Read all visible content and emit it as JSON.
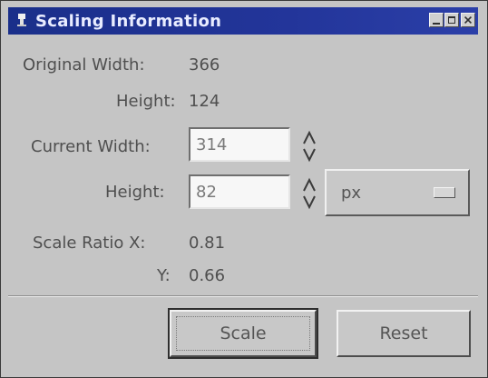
{
  "window": {
    "title": "Scaling Information",
    "icon": "app-icon",
    "controls": [
      "minimize-icon",
      "maximize-icon",
      "close-icon"
    ]
  },
  "original": {
    "width_label": "Original Width:",
    "width_value": "366",
    "height_label": "Height:",
    "height_value": "124"
  },
  "current": {
    "width_label": "Current Width:",
    "width_value": "314",
    "height_label": "Height:",
    "height_value": "82",
    "unit": "px"
  },
  "ratio": {
    "x_label": "Scale Ratio X:",
    "x_value": "0.81",
    "y_label": "Y:",
    "y_value": "0.66"
  },
  "buttons": {
    "scale": "Scale",
    "reset": "Reset"
  }
}
